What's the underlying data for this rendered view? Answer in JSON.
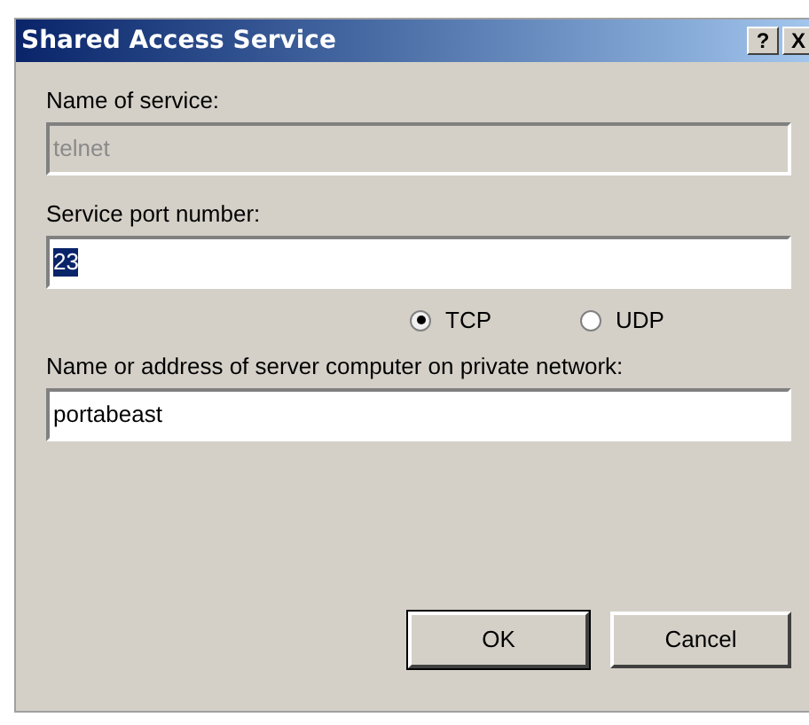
{
  "window": {
    "title": "Shared Access Service",
    "title_buttons": [
      "?",
      "X"
    ]
  },
  "fields": [
    {
      "label": "Name of service:",
      "value": "telnet",
      "disabled": true,
      "text_selected": false
    },
    {
      "label": "Service port number:",
      "value": "23",
      "disabled": false,
      "text_selected": true
    },
    {
      "label": "Name or address of server computer on private network:",
      "value": "portabeast",
      "disabled": false,
      "text_selected": false
    }
  ],
  "protocols": [
    {
      "label": "TCP",
      "selected": true
    },
    {
      "label": "UDP",
      "selected": false
    }
  ],
  "buttons": [
    {
      "label": "OK",
      "default": true
    },
    {
      "label": "Cancel",
      "default": false
    }
  ]
}
